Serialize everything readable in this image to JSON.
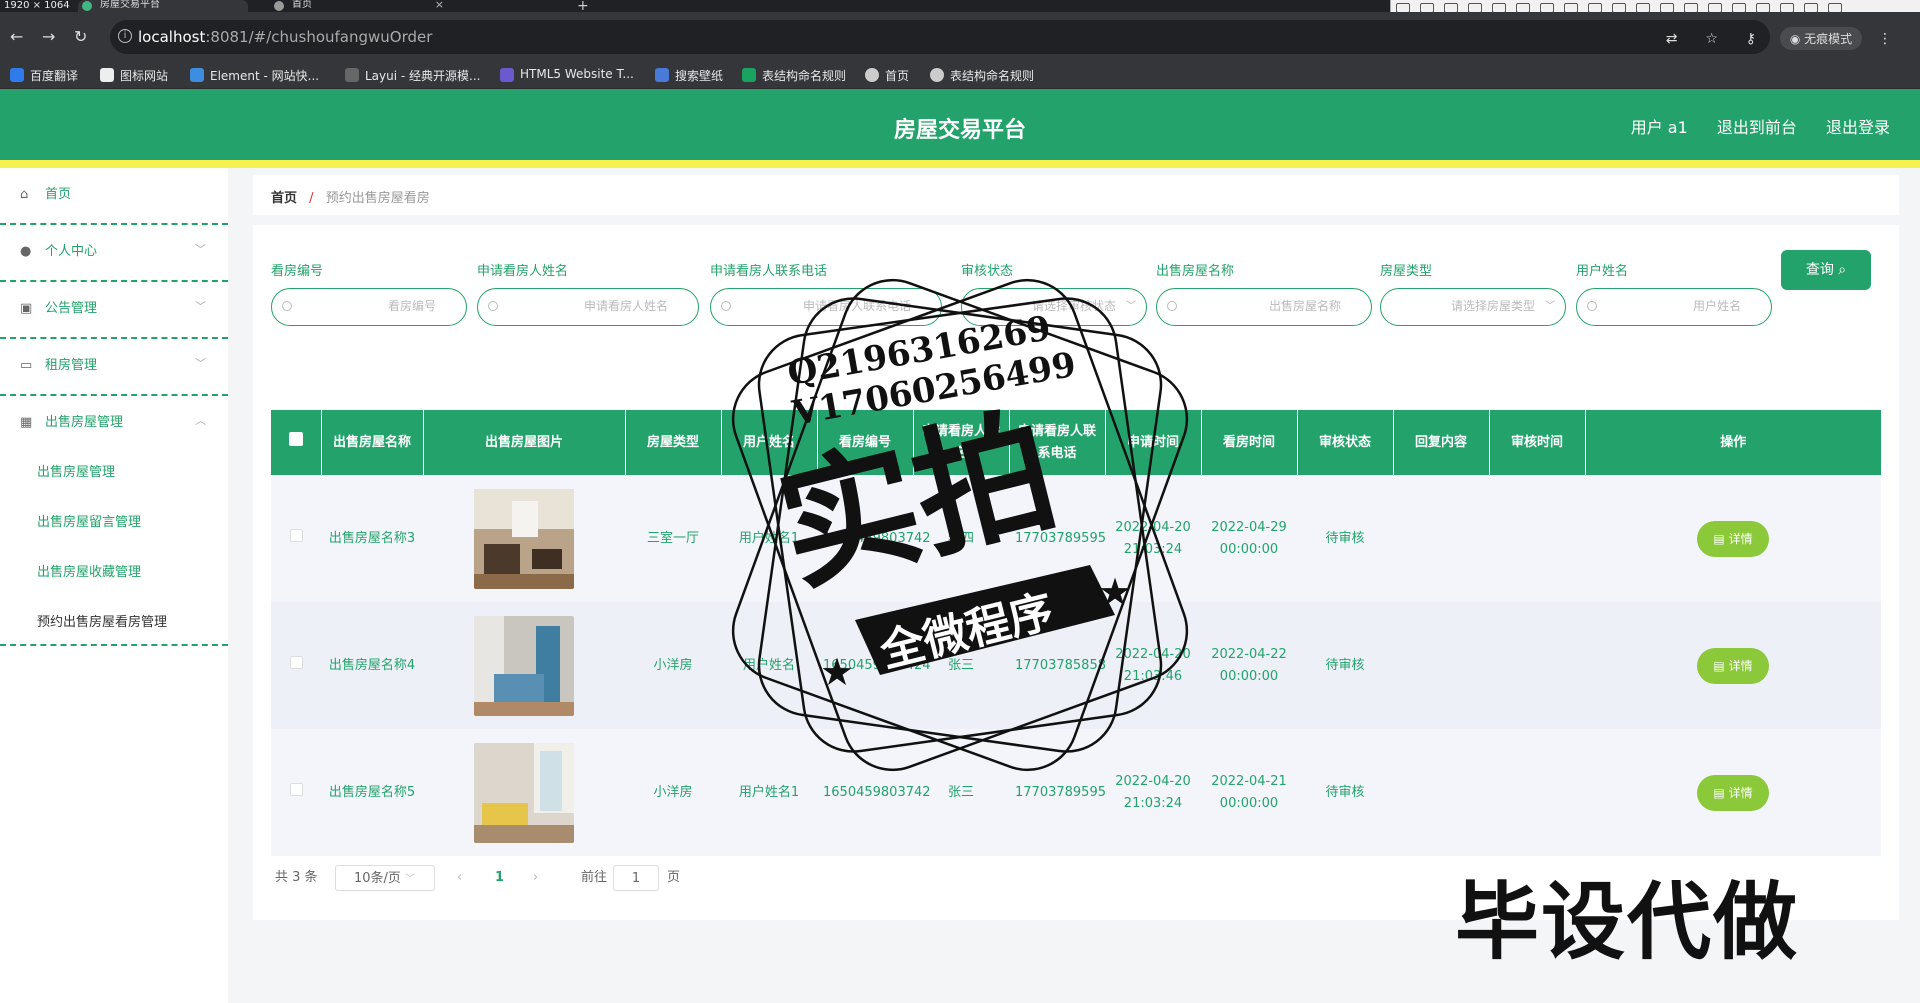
{
  "browser": {
    "dims": "1920 × 1064",
    "tabs": [
      {
        "title": "房屋交易平台",
        "active": true
      },
      {
        "title": "首页",
        "active": false
      }
    ],
    "url_host": "localhost",
    "url_path": ":8081/#/chushoufangwuOrder",
    "incognito_label": "无痕模式",
    "bookmarks": [
      "百度翻译",
      "图标网站",
      "Element - 网站快...",
      "Layui - 经典开源模...",
      "HTML5 Website T...",
      "搜索壁纸",
      "表结构命名规则",
      "首页",
      "表结构命名规则"
    ]
  },
  "header": {
    "title": "房屋交易平台",
    "user": "用户 a1",
    "to_front": "退出到前台",
    "logout": "退出登录"
  },
  "sidebar": {
    "items": [
      {
        "label": "首页",
        "icon": "home-icon"
      },
      {
        "label": "个人中心",
        "icon": "user-icon"
      },
      {
        "label": "公告管理",
        "icon": "clipboard-icon"
      },
      {
        "label": "租房管理",
        "icon": "chat-icon"
      },
      {
        "label": "出售房屋管理",
        "icon": "building-icon"
      }
    ],
    "sub_items": [
      "出售房屋管理",
      "出售房屋留言管理",
      "出售房屋收藏管理",
      "预约出售房屋看房管理"
    ]
  },
  "breadcrumb": {
    "home": "首页",
    "sep": "/",
    "current": "预约出售房屋看房"
  },
  "filters": [
    {
      "label": "看房编号",
      "placeholder": "看房编号"
    },
    {
      "label": "申请看房人姓名",
      "placeholder": "申请看房人姓名"
    },
    {
      "label": "申请看房人联系电话",
      "placeholder": "申请看房人联系电话"
    },
    {
      "label": "审核状态",
      "placeholder": "请选择审核状态"
    },
    {
      "label": "出售房屋名称",
      "placeholder": "出售房屋名称"
    },
    {
      "label": "房屋类型",
      "placeholder": "请选择房屋类型"
    },
    {
      "label": "用户姓名",
      "placeholder": "用户姓名"
    }
  ],
  "query_label": "查询",
  "table": {
    "headers": [
      "出售房屋名称",
      "出售房屋图片",
      "房屋类型",
      "用户姓名",
      "看房编号",
      "申请看房人姓名",
      "申请看房人联系电话",
      "申请时间",
      "看房时间",
      "审核状态",
      "回复内容",
      "审核时间",
      "操作"
    ],
    "rows": [
      {
        "name": "出售房屋名称3",
        "type": "三室一厅",
        "user": "用户姓名1",
        "no": "1650459803742",
        "applicant": "李四",
        "phone": "17703789595",
        "apply_time": "2022-04-20 21:03:24",
        "view_time": "2022-04-29 00:00:00",
        "status": "待审核",
        "reply": "",
        "audit_time": ""
      },
      {
        "name": "出售房屋名称4",
        "type": "小洋房",
        "user": "用户姓名",
        "no": "1650459803424",
        "applicant": "张三",
        "phone": "17703785858",
        "apply_time": "2022-04-20 21:03:46",
        "view_time": "2022-04-22 00:00:00",
        "status": "待审核",
        "reply": "",
        "audit_time": ""
      },
      {
        "name": "出售房屋名称5",
        "type": "小洋房",
        "user": "用户姓名1",
        "no": "1650459803742",
        "applicant": "张三",
        "phone": "17703789595",
        "apply_time": "2022-04-20 21:03:24",
        "view_time": "2022-04-21 00:00:00",
        "status": "待审核",
        "reply": "",
        "audit_time": ""
      }
    ],
    "detail_label": "详情"
  },
  "pagination": {
    "total": "共 3 条",
    "page_size": "10条/页",
    "prev": "‹",
    "current": "1",
    "next": "›",
    "goto": "前往",
    "goto_value": "1",
    "page_unit": "页"
  },
  "watermark": {
    "qq": "Q2196316269",
    "vx": "V17060256499",
    "main": "实拍",
    "banner": "全微程序",
    "corner": "毕设代做"
  }
}
